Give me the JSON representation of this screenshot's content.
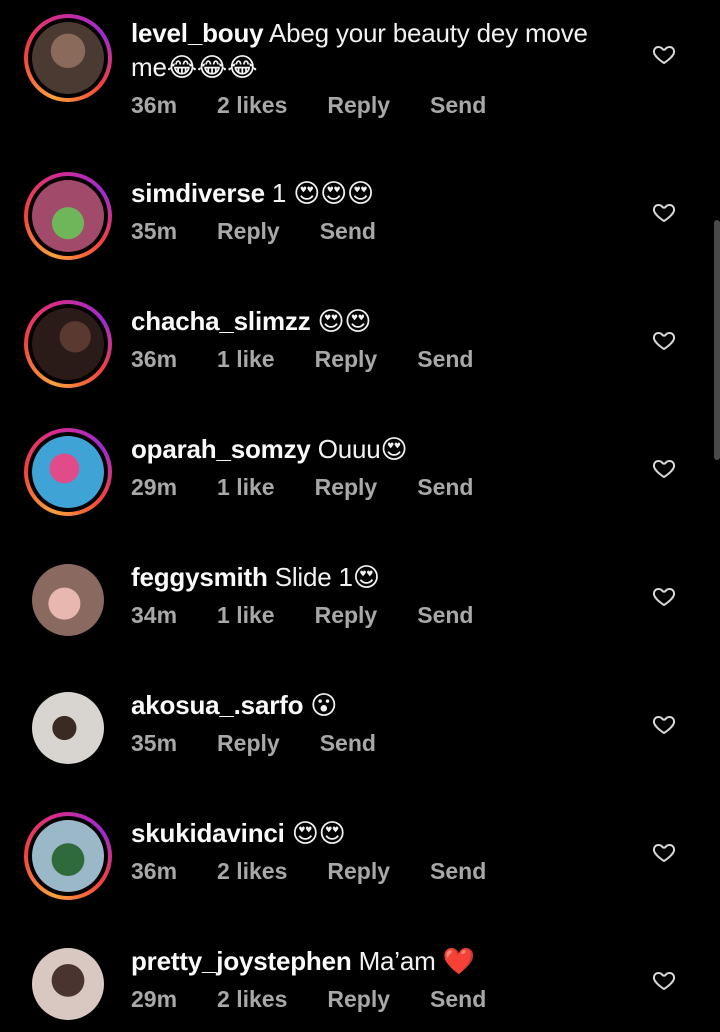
{
  "comments": [
    {
      "username": "level_bouy",
      "text": "Abeg your beauty dey move",
      "text2": "me😂😂😂",
      "time": "36m",
      "likes": "2 likes",
      "reply": "Reply",
      "send": "Send",
      "story": true,
      "avatar_color": "#5a4a42"
    },
    {
      "username": "simdiverse",
      "text": "1 😍😍😍",
      "time": "35m",
      "likes": "",
      "reply": "Reply",
      "send": "Send",
      "story": true,
      "avatar_color": "#a14a6a"
    },
    {
      "username": "chacha_slimzz",
      "text": "😍😍",
      "time": "36m",
      "likes": "1 like",
      "reply": "Reply",
      "send": "Send",
      "story": true,
      "avatar_color": "#2b1b18"
    },
    {
      "username": "oparah_somzy",
      "text": "Ouuu😍",
      "time": "29m",
      "likes": "1 like",
      "reply": "Reply",
      "send": "Send",
      "story": true,
      "avatar_color": "#3fa3d6"
    },
    {
      "username": "feggysmith",
      "text": "Slide 1😍",
      "time": "34m",
      "likes": "1 like",
      "reply": "Reply",
      "send": "Send",
      "story": false,
      "avatar_color": "#b48a80"
    },
    {
      "username": "akosua_.sarfo",
      "text": "😮",
      "time": "35m",
      "likes": "",
      "reply": "Reply",
      "send": "Send",
      "story": false,
      "avatar_color": "#d8d4cf"
    },
    {
      "username": "skukidavinci",
      "text": "😍😍",
      "time": "36m",
      "likes": "2 likes",
      "reply": "Reply",
      "send": "Send",
      "story": true,
      "avatar_color": "#6a8b5a"
    },
    {
      "username": "pretty_joystephen",
      "text": "Ma’am ❤️",
      "time": "29m",
      "likes": "2 likes",
      "reply": "Reply",
      "send": "Send",
      "story": false,
      "avatar_color": "#d9c8c2"
    }
  ],
  "colors": {
    "background": "#000000",
    "meta": "#a8a8a8",
    "text": "#f2f2f2"
  }
}
